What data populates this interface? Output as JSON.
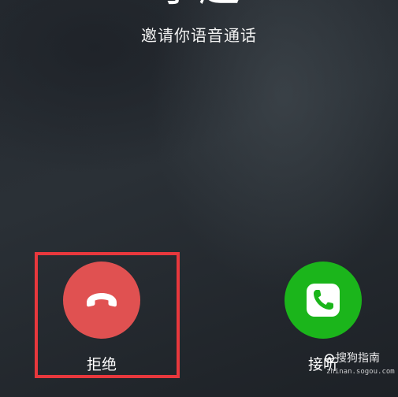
{
  "call": {
    "caller_name": "小趣",
    "status_text": "邀请你语音通话"
  },
  "actions": {
    "decline_label": "拒绝",
    "accept_label": "接听"
  },
  "colors": {
    "decline": "#e05151",
    "accept": "#1bb51b",
    "highlight": "#e8383d"
  },
  "icons": {
    "decline": "phone-hangup-icon",
    "accept": "phone-icon"
  },
  "watermark": {
    "brand": "搜狗指南",
    "url": "zhinan.sogou.com"
  }
}
